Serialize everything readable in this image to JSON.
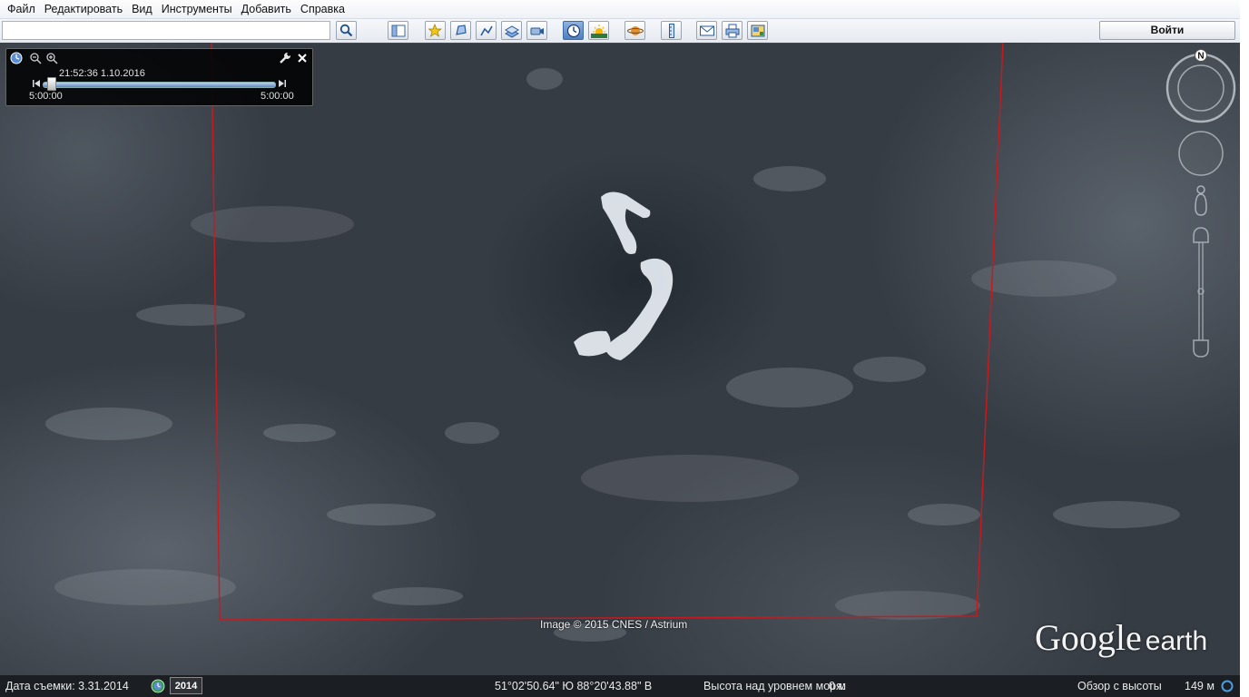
{
  "menu": {
    "items": [
      "Файл",
      "Редактировать",
      "Вид",
      "Инструменты",
      "Добавить",
      "Справка"
    ]
  },
  "toolbar": {
    "search_value": "",
    "login_label": "Войти",
    "icons": [
      "sidebar-toggle-icon",
      "add-placemark-icon",
      "add-polygon-icon",
      "add-path-icon",
      "image-overlay-icon",
      "record-tour-icon",
      "historical-imagery-icon",
      "sunlight-icon",
      "planets-icon",
      "ruler-icon",
      "email-icon",
      "print-icon",
      "save-image-icon"
    ],
    "active_icon": "historical-imagery-icon"
  },
  "time_slider": {
    "current": "21:52:36 1.10.2016",
    "start": "5:00:00",
    "end": "5:00:00",
    "position": 0.03
  },
  "map": {
    "attribution": "Image © 2015 CNES / Astrium",
    "logo_main": "Google",
    "logo_sub": "earth",
    "overlay_color": "#c8191e"
  },
  "status": {
    "date_label": "Дата съемки: 3.31.2014",
    "year": "2014",
    "coordinates": "51°02'50.64\" Ю  88°20'43.88\" В",
    "elevation_label": "Высота над уровнем моря:",
    "elevation_value": "0 м",
    "eye_label": "Обзор с высоты",
    "eye_value": "149 м"
  },
  "nav": {
    "north_label": "N"
  }
}
